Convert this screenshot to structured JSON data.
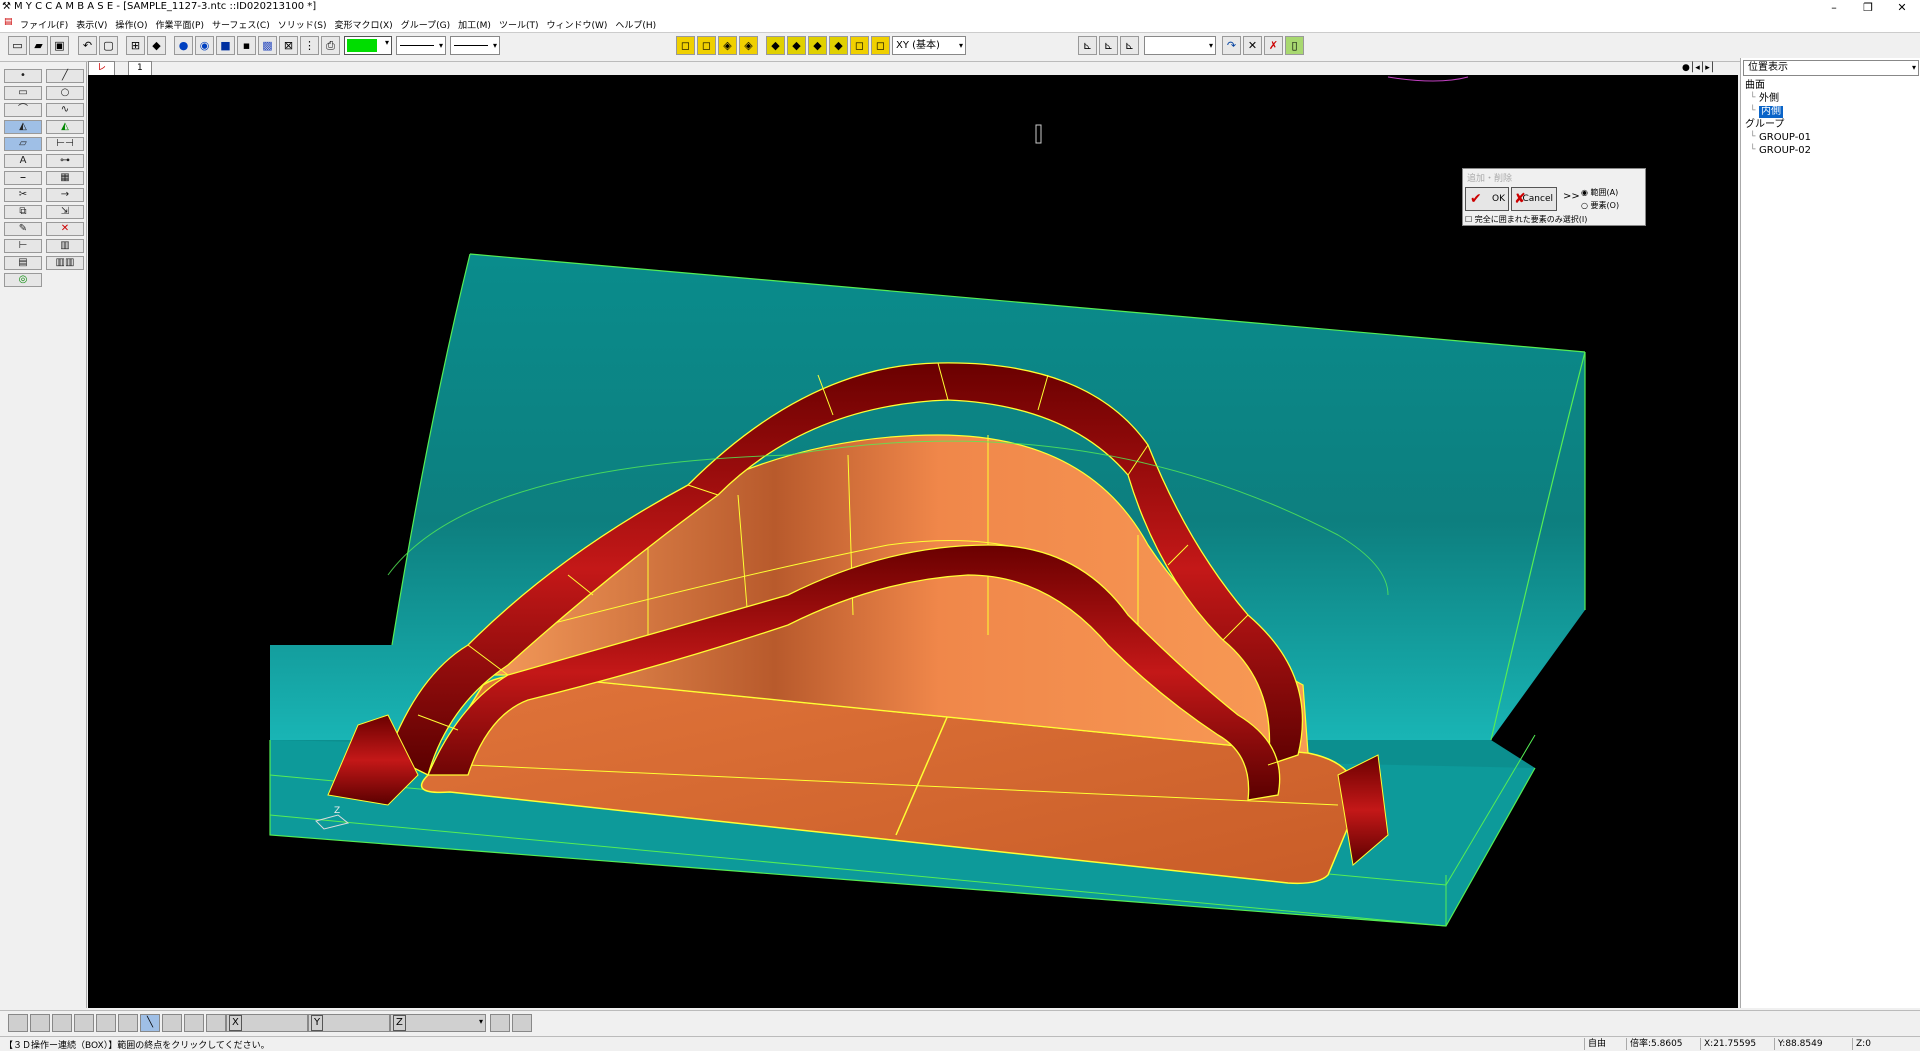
{
  "window": {
    "title": "M Y C  C A M B A S E  - [SAMPLE_1127-3.ntc ::ID020213100 *]",
    "controls": {
      "minimize": "–",
      "maximize": "❐",
      "close": "✕"
    }
  },
  "menu": [
    "ファイル(F)",
    "表示(V)",
    "操作(O)",
    "作業平面(P)",
    "サーフェス(C)",
    "ソリッド(S)",
    "変形マクロ(X)",
    "グループ(G)",
    "加工(M)",
    "ツール(T)",
    "ウィンドウ(W)",
    "ヘルプ(H)"
  ],
  "toolbar": {
    "view_select": "XY (基本)",
    "color_swatch": "#00dd00",
    "right_select": ""
  },
  "tabs": [
    "レイヤ",
    "1"
  ],
  "palette": {
    "icons": [
      "point-icon",
      "line-icon",
      "rect-icon",
      "circle-icon",
      "arc-icon",
      "spline-icon",
      "surface-icon",
      "surface-green-icon",
      "plane-icon",
      "dimension-icon",
      "text-icon",
      "polyline-icon",
      "offset-icon",
      "hatch-icon",
      "trim-icon",
      "extend-icon",
      "copy-icon",
      "move-icon",
      "edit-icon",
      "delete-icon",
      "measure-icon",
      "grid-icon",
      "layer-icon",
      "numeric-icon",
      "solid-icon"
    ],
    "active": [
      6,
      8
    ]
  },
  "dialog": {
    "title": "追加・削除",
    "ok": "OK",
    "cancel": "Cancel",
    "more": ">>",
    "radio_range": "範囲(A)",
    "radio_element": "要素(O)",
    "checkbox": "完全に囲まれた要素のみ選択(I)"
  },
  "viewport": {
    "axis_label": "Z",
    "colors": {
      "block": "#0c9e9e",
      "floor": "#d96a32",
      "bead": "#8b0a0a",
      "edges_yellow": "#ffff33",
      "edges_green": "#55ee55"
    }
  },
  "right_panel": {
    "dropdown": "位置表示",
    "tree": [
      {
        "label": "曲面",
        "level": 0,
        "selected": false
      },
      {
        "label": "外側",
        "level": 1,
        "selected": false
      },
      {
        "label": "内側",
        "level": 1,
        "selected": true
      },
      {
        "label": "グループ",
        "level": 0,
        "selected": false
      },
      {
        "label": "GROUP-01",
        "level": 1,
        "selected": false
      },
      {
        "label": "GROUP-02",
        "level": 1,
        "selected": false
      }
    ]
  },
  "bottom": {
    "x_label": "X",
    "y_label": "Y",
    "z_label": "Z"
  },
  "status": {
    "message": "【３Ｄ操作ー連続（BOX）】範囲の終点をクリックしてください。",
    "mode": "自由",
    "scale": "倍率:5.8605",
    "x": "X:21.75595",
    "y": "Y:88.8549",
    "z": "Z:0"
  }
}
